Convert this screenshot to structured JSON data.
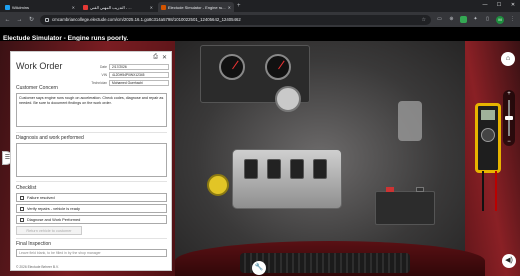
{
  "browser": {
    "tabs": [
      {
        "title": "WAdmins",
        "active": false,
        "color": "#1da1f2"
      },
      {
        "title": "التدريب المهني الفني - ...",
        "active": false,
        "color": "#e53935"
      },
      {
        "title": "Electude Simulator - Engine ru...",
        "active": true,
        "color": "#d35400"
      }
    ],
    "url": "cmcambriancollege.electude.com/cm/2025.16.1.go8c314a5798/1010022501_12405642_12405462",
    "avatar_letter": "M",
    "newtab": "+",
    "minimize": "—",
    "maximize": "☐",
    "close": "✕"
  },
  "app": {
    "title": "Electude Simulator - Engine runs poorly."
  },
  "work_order": {
    "title": "Work Order",
    "fields": [
      {
        "label": "Date",
        "value": "2/17/2026"
      },
      {
        "label": "VIN",
        "value": "4L2DH54P0WX12345"
      },
      {
        "label": "Technician",
        "value": "Mohamed Guerhachi"
      }
    ],
    "customer_concern_heading": "Customer Concern",
    "customer_concern_text": "Customer says engine runs rough on acceleration. Check codes, diagnose and repair as needed. Be sure to document findings on the work order.",
    "diagnosis_heading": "Diagnosis and work performed",
    "diagnosis_text": "",
    "checklist_heading": "Checklist",
    "checklist": [
      {
        "label": "Failure resolved",
        "checked": false
      },
      {
        "label": "Verify repairs - vehicle is ready",
        "checked": false
      },
      {
        "label": "Diagnose and Work Performed",
        "checked": false
      }
    ],
    "return_button": "Return vehicle to customer",
    "final_inspection_heading": "Final Inspection",
    "final_inspection_placeholder": "Leave field blank, to be filled in by the shop manager",
    "copyright": "© 2026 Electude Beheer B.V."
  },
  "colors": {
    "accent": "#e7b400",
    "header_bg": "#000000",
    "car_body": "#7a1d22"
  }
}
